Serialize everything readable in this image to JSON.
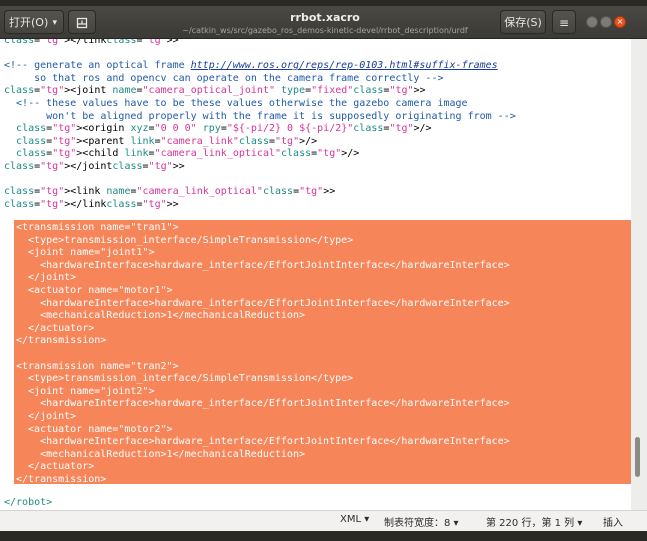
{
  "window": {
    "title": "rrbot.xacro",
    "subtitle": "~/catkin_ws/src/gazebo_ros_demos-kinetic-devel/rrbot_description/urdf"
  },
  "toolbar": {
    "open_label": "打开(O)",
    "save_label": "保存(S)"
  },
  "icons": {
    "new_doc": "new-document-icon",
    "menu": "hamburger-menu-icon",
    "minimize": "window-minimize-icon",
    "maximize": "window-maximize-icon",
    "close": "window-close-icon",
    "open_caret": "chevron-down-icon"
  },
  "colors": {
    "selection": "#f7855a",
    "close_button": "#e95420",
    "comment": "#205aa8",
    "tag": "#1e8c86",
    "string": "#d6359a"
  },
  "editor": {
    "upper_lines": [
      "</link>",
      "",
      "<!-- generate an optical frame http://www.ros.org/reps/rep-0103.html#suffix-frames",
      "     so that ros and opencv can operate on the camera frame correctly -->",
      "<joint name=\"camera_optical_joint\" type=\"fixed\">",
      "  <!-- these values have to be these values otherwise the gazebo camera image",
      "       won't be aligned properly with the frame it is supposedly originating from -->",
      "  <origin xyz=\"0 0 0\" rpy=\"${-pi/2} 0 ${-pi/2}\"/>",
      "  <parent link=\"camera_link\"/>",
      "  <child link=\"camera_link_optical\"/>",
      "</joint>",
      "",
      "<link name=\"camera_link_optical\">",
      "</link>"
    ],
    "selected_lines": [
      "<transmission name=\"tran1\">",
      "  <type>transmission_interface/SimpleTransmission</type>",
      "  <joint name=\"joint1\">",
      "    <hardwareInterface>hardware_interface/EffortJointInterface</hardwareInterface>",
      "  </joint>",
      "  <actuator name=\"motor1\">",
      "    <hardwareInterface>hardware_interface/EffortJointInterface</hardwareInterface>",
      "    <mechanicalReduction>1</mechanicalReduction>",
      "  </actuator>",
      "</transmission>",
      "",
      "<transmission name=\"tran2\">",
      "  <type>transmission_interface/SimpleTransmission</type>",
      "  <joint name=\"joint2\">",
      "    <hardwareInterface>hardware_interface/EffortJointInterface</hardwareInterface>",
      "  </joint>",
      "  <actuator name=\"motor2\">",
      "    <hardwareInterface>hardware_interface/EffortJointInterface</hardwareInterface>",
      "    <mechanicalReduction>1</mechanicalReduction>",
      "  </actuator>",
      "</transmission>"
    ],
    "closing_line": "</robot>"
  },
  "statusbar": {
    "language": "XML",
    "tab_width": "制表符宽度：8",
    "position": "第 220 行，第 1 列",
    "mode": "插入"
  }
}
